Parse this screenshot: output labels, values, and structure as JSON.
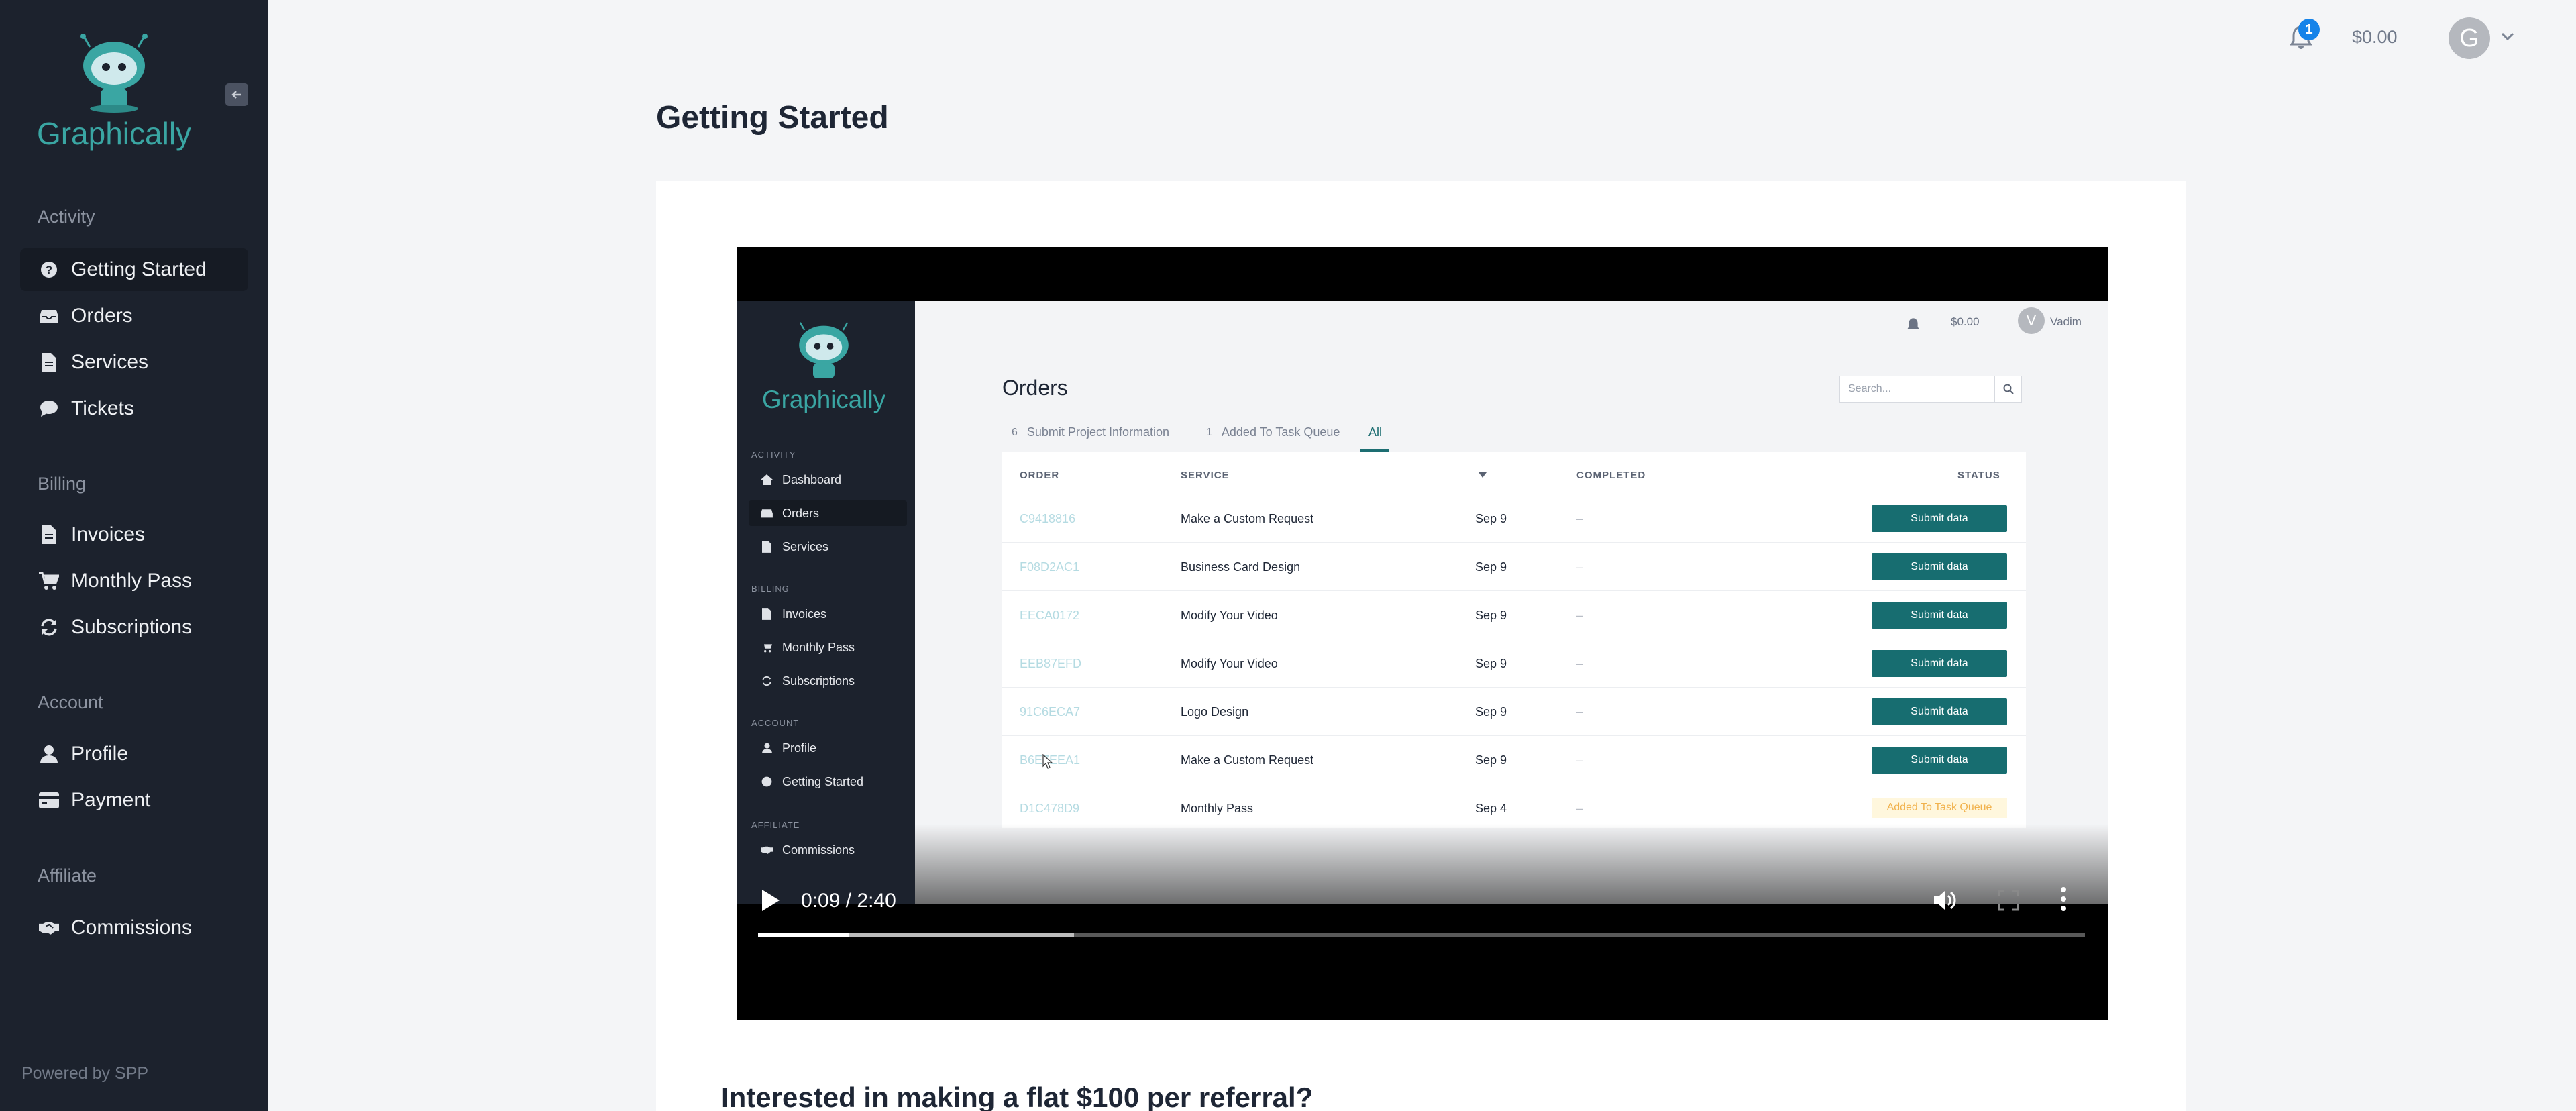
{
  "app": {
    "logo_text": "Graphically",
    "powered_by": "Powered by SPP"
  },
  "sidebar": {
    "sections": [
      {
        "label": "Activity",
        "items": [
          {
            "label": "Getting Started",
            "icon": "question-circle-icon",
            "active": true
          },
          {
            "label": "Orders",
            "icon": "inbox-icon"
          },
          {
            "label": "Services",
            "icon": "file-icon"
          },
          {
            "label": "Tickets",
            "icon": "comment-icon"
          }
        ]
      },
      {
        "label": "Billing",
        "items": [
          {
            "label": "Invoices",
            "icon": "file-icon"
          },
          {
            "label": "Monthly Pass",
            "icon": "cart-icon"
          },
          {
            "label": "Subscriptions",
            "icon": "refresh-icon"
          }
        ]
      },
      {
        "label": "Account",
        "items": [
          {
            "label": "Profile",
            "icon": "user-icon"
          },
          {
            "label": "Payment",
            "icon": "credit-card-icon"
          }
        ]
      },
      {
        "label": "Affiliate",
        "items": [
          {
            "label": "Commissions",
            "icon": "handshake-icon"
          }
        ]
      }
    ]
  },
  "header": {
    "notification_count": "1",
    "balance": "$0.00",
    "avatar_letter": "G"
  },
  "main": {
    "title": "Getting Started",
    "referral_heading": "Interested in making a flat $100 per referral?"
  },
  "video": {
    "time": "0:09 / 2:40",
    "progress": 0.068,
    "buffered": 0.238,
    "inner": {
      "balance": "$0.00",
      "avatar_letter": "V",
      "user": "Vadim",
      "sidebar": {
        "activity": "ACTIVITY",
        "billing": "BILLING",
        "account": "ACCOUNT",
        "affiliate": "AFFILIATE",
        "items": [
          "Dashboard",
          "Orders",
          "Services",
          "Invoices",
          "Monthly Pass",
          "Subscriptions",
          "Profile",
          "Getting Started",
          "Commissions"
        ]
      },
      "title": "Orders",
      "search_placeholder": "Search...",
      "tabs": [
        {
          "count": "6",
          "label": "Submit Project Information"
        },
        {
          "count": "1",
          "label": "Added To Task Queue"
        },
        {
          "count": "",
          "label": "All"
        }
      ],
      "columns": [
        "ORDER",
        "SERVICE",
        "COMPLETED",
        "STATUS"
      ],
      "rows": [
        {
          "order": "C9418816",
          "service": "Make a Custom Request",
          "date": "Sep 9",
          "completed": "–",
          "status": "Submit data"
        },
        {
          "order": "F08D2AC1",
          "service": "Business Card Design",
          "date": "Sep 9",
          "completed": "–",
          "status": "Submit data"
        },
        {
          "order": "EECA0172",
          "service": "Modify Your Video",
          "date": "Sep 9",
          "completed": "–",
          "status": "Submit data"
        },
        {
          "order": "EEB87EFD",
          "service": "Modify Your Video",
          "date": "Sep 9",
          "completed": "–",
          "status": "Submit data"
        },
        {
          "order": "91C6ECA7",
          "service": "Logo Design",
          "date": "Sep 9",
          "completed": "–",
          "status": "Submit data"
        },
        {
          "order": "B6E7EEA1",
          "service": "Make a Custom Request",
          "date": "Sep 9",
          "completed": "–",
          "status": "Submit data"
        },
        {
          "order": "D1C478D9",
          "service": "Monthly Pass",
          "date": "Sep 4",
          "completed": "–",
          "status": "Added To Task Queue"
        }
      ]
    }
  },
  "colors": {
    "sidebar_bg": "#1c222d",
    "accent": "#176d70",
    "badge": "#1583e9"
  }
}
